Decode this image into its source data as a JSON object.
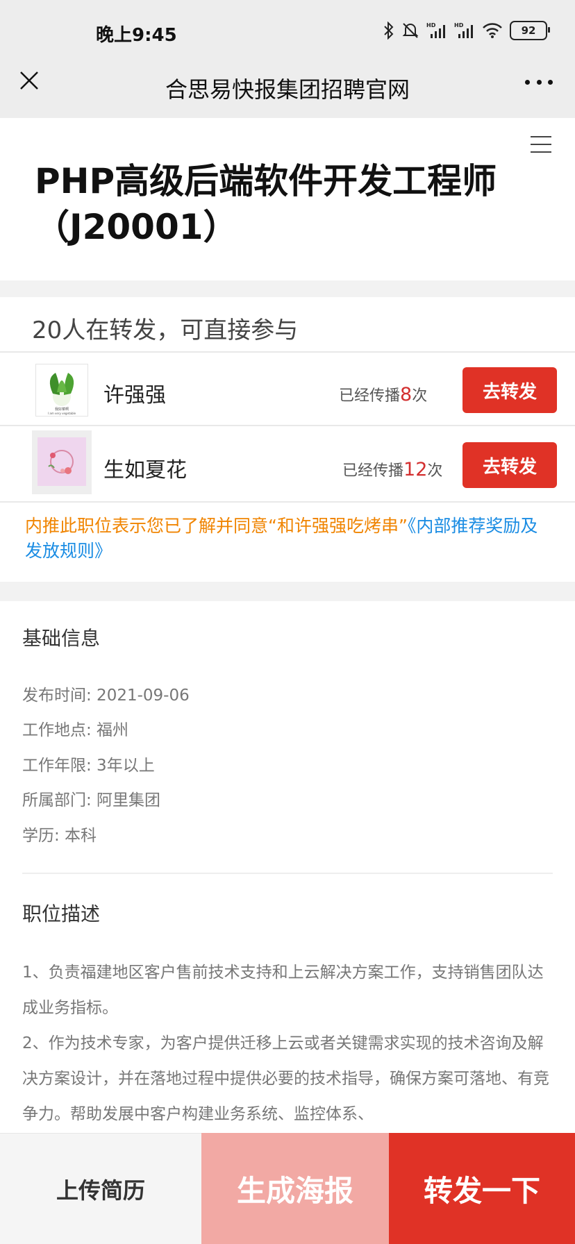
{
  "status": {
    "time": "晚上9:45",
    "battery": "92"
  },
  "titlebar": {
    "title": "合思易快报集团招聘官网"
  },
  "job": {
    "title": "PHP高级后端软件开发工程师（J20001）"
  },
  "share": {
    "count_text": "20人在转发，可直接参与",
    "people": [
      {
        "name": "许强强",
        "spread_prefix": "已经传播",
        "spread_count": "8",
        "spread_suffix": "次",
        "button": "去转发",
        "avatar_caption": "我好菜啊",
        "avatar_caption2": "I am very vegetable"
      },
      {
        "name": "生如夏花",
        "spread_prefix": "已经传播",
        "spread_count": "12",
        "spread_suffix": "次",
        "button": "去转发"
      }
    ]
  },
  "notice": {
    "text": "内推此职位表示您已了解并同意“和许强强吃烤串”",
    "link": "《内部推荐奖励及发放规则》"
  },
  "basic_info": {
    "title": "基础信息",
    "rows": [
      "发布时间: 2021-09-06",
      "工作地点: 福州",
      "工作年限: 3年以上",
      "所属部门: 阿里集团",
      "学历: 本科"
    ]
  },
  "description": {
    "title": "职位描述",
    "text": "1、负责福建地区客户售前技术支持和上云解决方案工作，支持销售团队达成业务指标。\n2、作为技术专家，为客户提供迁移上云或者关键需求实现的技术咨询及解决方案设计，并在落地过程中提供必要的技术指导，确保方案可落地、有竞争力。帮助发展中客户构建业务系统、监控体系、"
  },
  "bottom": {
    "upload": "上传简历",
    "poster": "生成海报",
    "forward": "转发一下"
  },
  "colors": {
    "accent": "#e03226",
    "poster": "#f2a9a4",
    "notice": "#f08400",
    "link": "#1a8ce3"
  }
}
